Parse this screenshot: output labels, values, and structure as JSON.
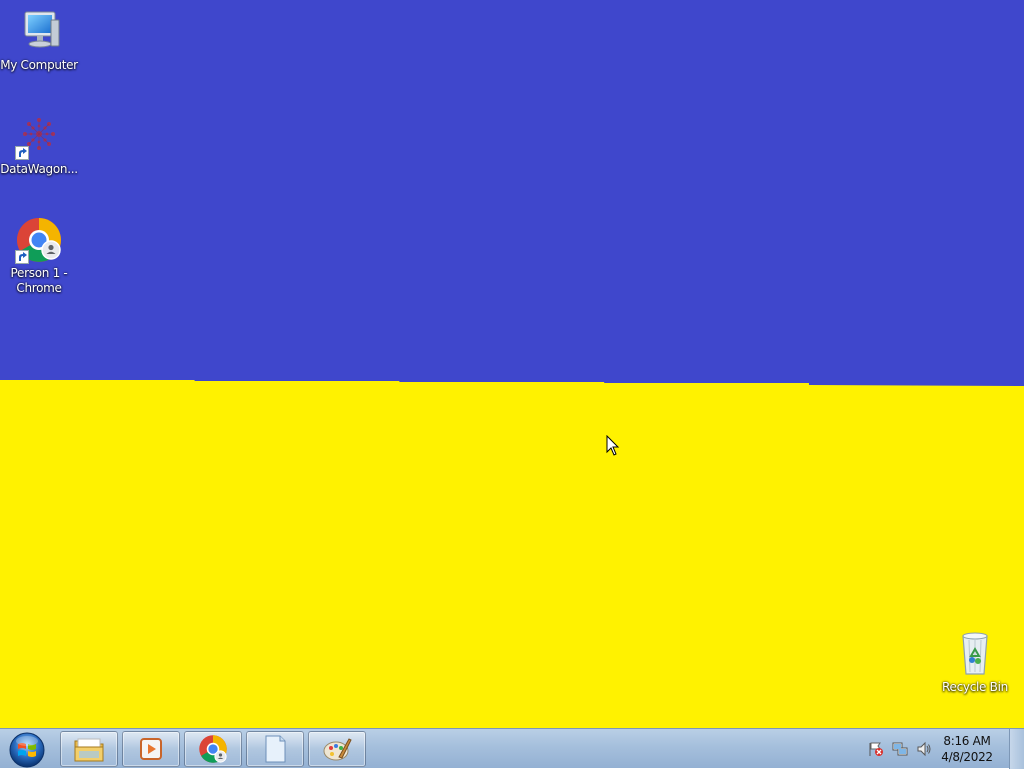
{
  "desktop": {
    "wallpaper_top_color": "#3f47cc",
    "wallpaper_bottom_color": "#fff200",
    "icons": [
      {
        "label": "My Computer",
        "icon": "computer-icon"
      },
      {
        "label": "DataWagon...",
        "icon": "datawagon-icon",
        "shortcut": true
      },
      {
        "label": "Person 1 - Chrome",
        "icon": "chrome-icon",
        "shortcut": true
      },
      {
        "label": "Recycle Bin",
        "icon": "recycle-bin-icon"
      }
    ]
  },
  "taskbar": {
    "start_button": "start-orb-icon",
    "pinned": [
      {
        "name": "Windows Explorer",
        "icon": "folder-icon"
      },
      {
        "name": "Media Player",
        "icon": "media-player-icon"
      },
      {
        "name": "Google Chrome",
        "icon": "chrome-icon"
      },
      {
        "name": "Notepad",
        "icon": "document-icon"
      },
      {
        "name": "Paint",
        "icon": "paint-icon"
      }
    ],
    "tray_icons": [
      "action-center-flag-icon",
      "network-icon",
      "volume-icon"
    ],
    "clock": {
      "time": "8:16 AM",
      "date": "4/8/2022"
    }
  }
}
